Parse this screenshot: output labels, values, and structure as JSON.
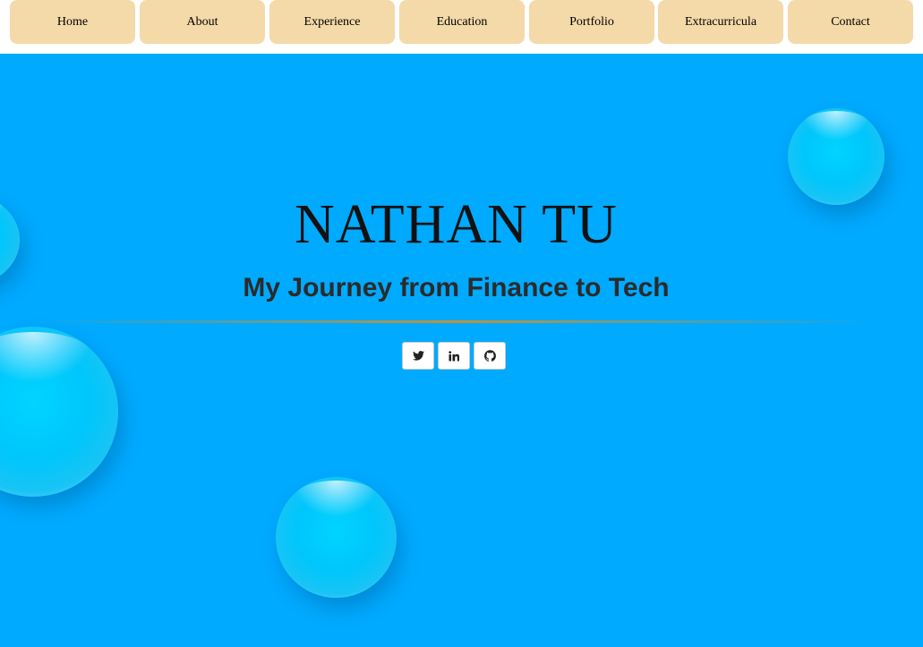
{
  "nav": {
    "items": [
      {
        "label": "Home"
      },
      {
        "label": "About"
      },
      {
        "label": "Experience"
      },
      {
        "label": "Education"
      },
      {
        "label": "Portfolio"
      },
      {
        "label": "Extracurricula"
      },
      {
        "label": "Contact"
      }
    ]
  },
  "hero": {
    "name": "NATHAN TU",
    "tagline": "My Journey from Finance to Tech",
    "background_color": "#00aaff"
  },
  "social": {
    "links": [
      {
        "icon": "twitter-icon"
      },
      {
        "icon": "linkedin-icon"
      },
      {
        "icon": "github-icon"
      }
    ]
  },
  "colors": {
    "nav_button": "#f4d9a9",
    "divider_accent": "#e48c14",
    "bubble": "#00ccff"
  }
}
